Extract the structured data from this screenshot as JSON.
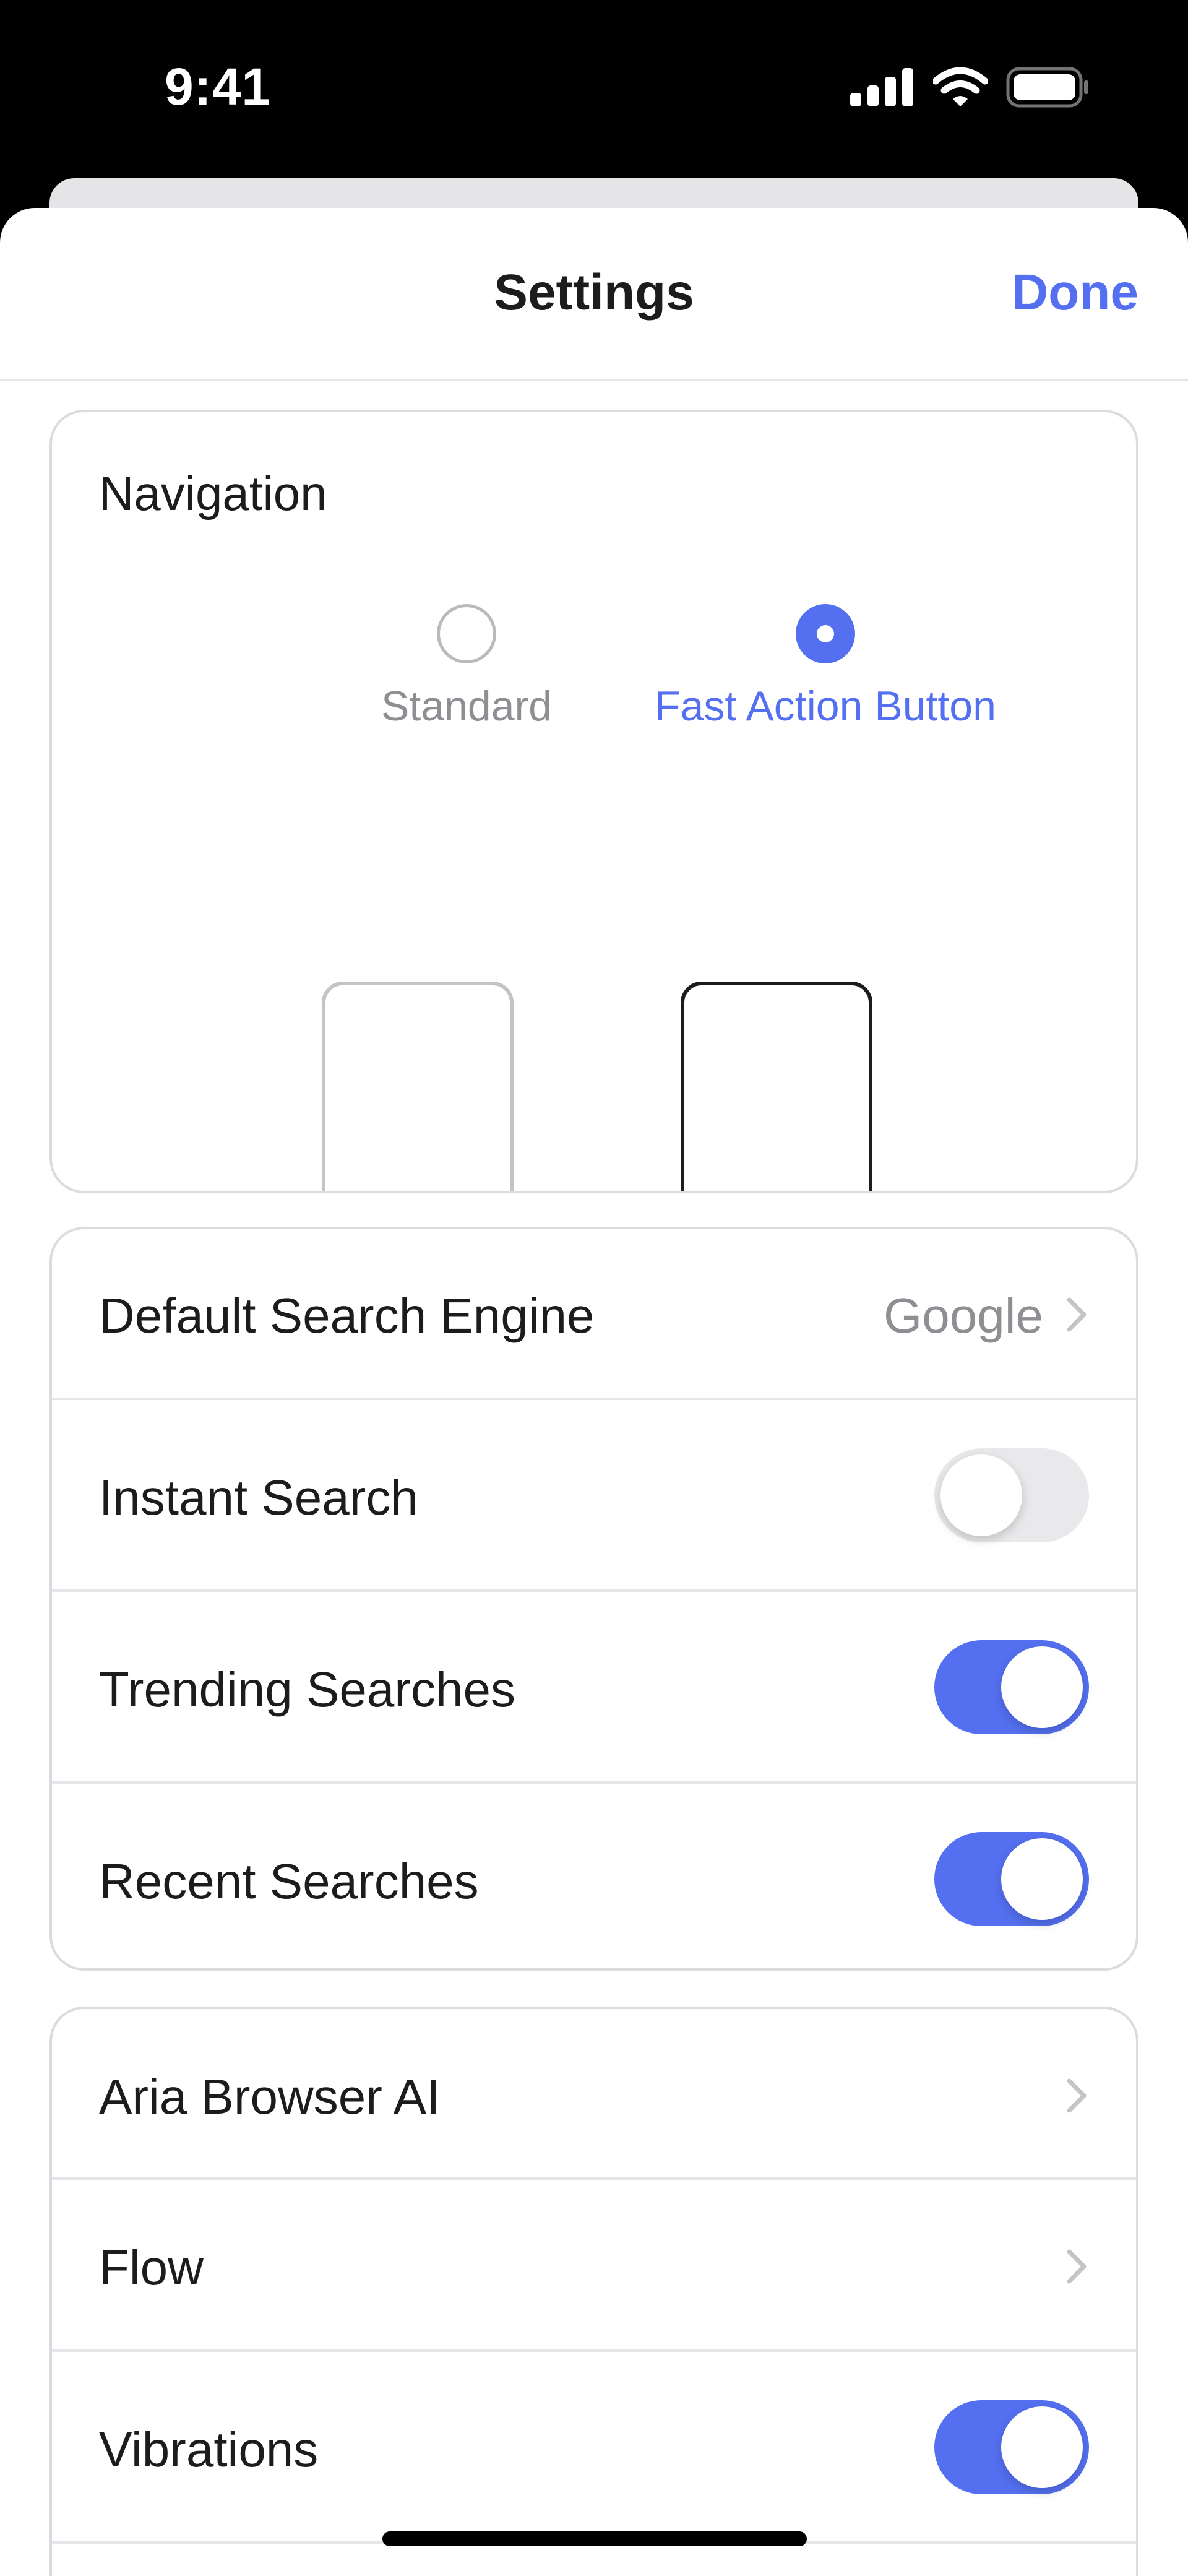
{
  "status_bar": {
    "time": "9:41"
  },
  "header": {
    "title": "Settings",
    "done_label": "Done"
  },
  "navigation": {
    "title": "Navigation",
    "options": [
      {
        "label": "Standard",
        "selected": false
      },
      {
        "label": "Fast Action Button",
        "selected": true
      }
    ]
  },
  "search_section": {
    "default_engine": {
      "label": "Default Search Engine",
      "value": "Google"
    },
    "instant_search": {
      "label": "Instant Search",
      "on": false
    },
    "trending_searches": {
      "label": "Trending Searches",
      "on": true
    },
    "recent_searches": {
      "label": "Recent Searches",
      "on": true
    }
  },
  "more_section": {
    "aria": {
      "label": "Aria Browser AI"
    },
    "flow": {
      "label": "Flow"
    },
    "vibrations": {
      "label": "Vibrations",
      "on": true
    }
  },
  "colors": {
    "accent": "#5470f0",
    "accent_light": "#cbd4fb",
    "text": "#1c1c1e",
    "secondary": "#8e8e93"
  }
}
